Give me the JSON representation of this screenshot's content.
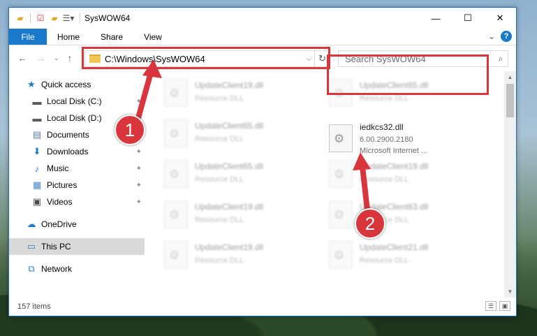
{
  "window": {
    "title": "SysWOW64",
    "controls": {
      "minimize": "—",
      "maximize": "☐",
      "close": "✕"
    }
  },
  "ribbon": {
    "tabs": [
      "File",
      "Home",
      "Share",
      "View"
    ],
    "expand_icon": "⌄",
    "help_icon": "?"
  },
  "address": {
    "path": "C:\\Windows\\SysWOW64",
    "dropdown": "⌵",
    "refresh": "↻"
  },
  "search": {
    "placeholder": "Search SysWOW64",
    "icon": "⌕"
  },
  "sidebar": {
    "items": [
      {
        "label": "Quick access",
        "icon": "star-icon",
        "glyph": "★",
        "color": "#1979ca"
      },
      {
        "label": "Local Disk (C:)",
        "icon": "drive-icon",
        "glyph": "▬",
        "color": "#5a5a5a"
      },
      {
        "label": "Local Disk (D:)",
        "icon": "drive-icon",
        "glyph": "▬",
        "color": "#5a5a5a"
      },
      {
        "label": "Documents",
        "icon": "documents-icon",
        "glyph": "▤",
        "color": "#5a7fa6"
      },
      {
        "label": "Downloads",
        "icon": "download-icon",
        "glyph": "⬇",
        "color": "#1979ca"
      },
      {
        "label": "Music",
        "icon": "music-icon",
        "glyph": "♪",
        "color": "#1979ca"
      },
      {
        "label": "Pictures",
        "icon": "pictures-icon",
        "glyph": "▦",
        "color": "#4a86c6"
      },
      {
        "label": "Videos",
        "icon": "videos-icon",
        "glyph": "▣",
        "color": "#4a4a4a"
      },
      {
        "label": "OneDrive",
        "icon": "cloud-icon",
        "glyph": "☁",
        "color": "#1979ca"
      },
      {
        "label": "This PC",
        "icon": "computer-icon",
        "glyph": "▭",
        "color": "#2c80c9"
      },
      {
        "label": "Network",
        "icon": "network-icon",
        "glyph": "⧉",
        "color": "#2c80c9"
      }
    ],
    "pin_glyph": "📌"
  },
  "files": {
    "left_column": [
      {
        "name": "UpdateClient19.dll",
        "type": "Resource DLL"
      },
      {
        "name": "UpdateClient65.dll",
        "type": "Resource DLL"
      },
      {
        "name": "UpdateClient65.dll",
        "type": "Resource DLL"
      },
      {
        "name": "UpdateClient19.dll",
        "type": "Resource DLL"
      },
      {
        "name": "UpdateClient19.dll",
        "type": "Resource DLL"
      }
    ],
    "right_column": [
      {
        "name": "UpdateClient65.dll",
        "type": "Resource DLL"
      },
      {
        "name": "iedkcs32.dll",
        "version": "6.00.2900.2180",
        "company": "Microsoft Internet ..."
      },
      {
        "name": "UpdateClient19.dll",
        "type": "Resource DLL"
      },
      {
        "name": "UpdateClient63.dll",
        "type": "Resource DLL"
      },
      {
        "name": "UpdateClient21.dll",
        "type": "Resource DLL"
      }
    ]
  },
  "status": {
    "count": "157 items"
  },
  "annotations": {
    "step1": "1",
    "step2": "2",
    "accent": "#d8363c"
  }
}
